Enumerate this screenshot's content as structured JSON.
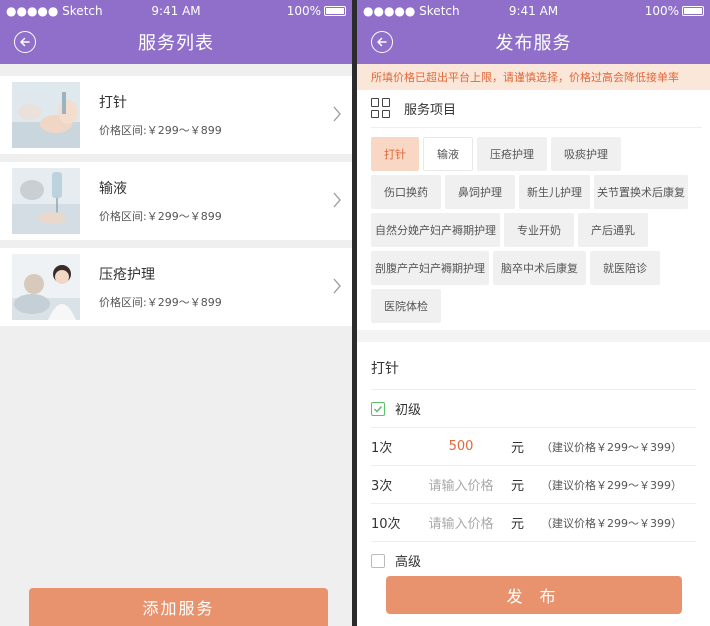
{
  "status_bar": {
    "carrier": "●●●●● Sketch",
    "time": "9:41 AM",
    "battery": "100%"
  },
  "left": {
    "title": "服务列表",
    "items": [
      {
        "name": "打针",
        "price": "价格区间:￥299～￥899",
        "icon": "injection-photo"
      },
      {
        "name": "输液",
        "price": "价格区间:￥299～￥899",
        "icon": "iv-drip-photo"
      },
      {
        "name": "压疮护理",
        "price": "价格区间:￥299～￥899",
        "icon": "nurse-photo"
      }
    ],
    "add_button": "添加服务"
  },
  "right": {
    "title": "发布服务",
    "notice": "所填价格已超出平台上限，请谨慎选择，价格过高会降低接单率",
    "section_title": "服务项目",
    "tag_rows": [
      [
        "打针",
        "输液",
        "压疮护理",
        "吸痰护理"
      ],
      [
        "伤口换药",
        "鼻饲护理",
        "新生儿护理",
        "关节置换术后康复"
      ],
      [
        "自然分娩产妇产褥期护理",
        "专业开奶",
        "产后通乳"
      ],
      [
        "剖腹产产妇产褥期护理",
        "脑卒中术后康复",
        "就医陪诊"
      ],
      [
        "医院体检"
      ]
    ],
    "selected_tag": "打针",
    "selected_title": "打针",
    "level_basic": "初级",
    "level_basic_checked": true,
    "price_rows": [
      {
        "times": "1次",
        "value": "500",
        "placeholder": false,
        "unit": "元",
        "hint": "（建议价格￥299～￥399）"
      },
      {
        "times": "3次",
        "value": "请输入价格",
        "placeholder": true,
        "unit": "元",
        "hint": "（建议价格￥299～￥399）"
      },
      {
        "times": "10次",
        "value": "请输入价格",
        "placeholder": true,
        "unit": "元",
        "hint": "（建议价格￥299～￥399）"
      }
    ],
    "level_advanced": "高级",
    "level_advanced_checked": false,
    "publish_button": "发 布"
  },
  "colors": {
    "header": "#8f6fc9",
    "accent": "#e8936e",
    "notice_text": "#e0683a",
    "notice_bg": "#fbe7d9",
    "check": "#5cbf6a"
  }
}
